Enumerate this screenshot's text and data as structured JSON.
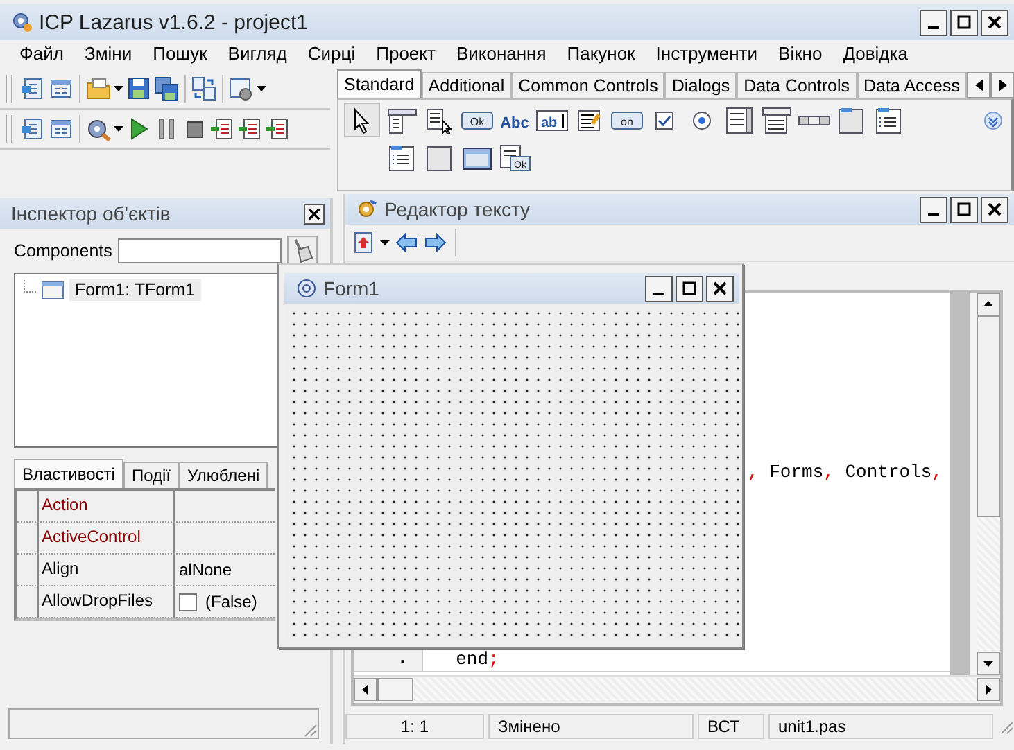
{
  "main_window": {
    "title": "ICP Lazarus v1.6.2 - project1",
    "menu": [
      "Файл",
      "Зміни",
      "Пошук",
      "Вигляд",
      "Сирці",
      "Проект",
      "Виконання",
      "Пакунок",
      "Інструменти",
      "Вікно",
      "Довідка"
    ],
    "palette": {
      "tabs": [
        {
          "label": "Standard",
          "selected": true
        },
        {
          "label": "Additional",
          "selected": false
        },
        {
          "label": "Common Controls",
          "selected": false
        },
        {
          "label": "Dialogs",
          "selected": false
        },
        {
          "label": "Data Controls",
          "selected": false
        },
        {
          "label": "Data Access",
          "selected": false
        }
      ],
      "components": [
        {
          "kind": "pointer",
          "selected": true
        },
        {
          "kind": "menu",
          "selected": false
        },
        {
          "kind": "popup",
          "selected": false
        },
        {
          "kind": "button",
          "label": "Ok",
          "selected": false
        },
        {
          "kind": "label",
          "label": "Abc",
          "selected": false
        },
        {
          "kind": "edit",
          "label": "ab",
          "selected": false
        },
        {
          "kind": "memo",
          "selected": false
        },
        {
          "kind": "toggle",
          "label": "on",
          "selected": false
        },
        {
          "kind": "checkbox",
          "selected": false
        },
        {
          "kind": "radio",
          "selected": false
        },
        {
          "kind": "listbox",
          "selected": false
        },
        {
          "kind": "combobox",
          "selected": false
        },
        {
          "kind": "scrollbar",
          "selected": false
        },
        {
          "kind": "groupbox",
          "selected": false
        },
        {
          "kind": "radiogroup",
          "selected": false
        },
        {
          "kind": "checkgroup",
          "selected": false
        },
        {
          "kind": "panel",
          "selected": false
        },
        {
          "kind": "frame",
          "selected": false
        },
        {
          "kind": "actionlist",
          "label": "Ok",
          "selected": false
        }
      ]
    }
  },
  "object_inspector": {
    "title": "Інспектор об'єктів",
    "filter_label": "Components",
    "tree": [
      {
        "label": "Form1: TForm1",
        "selected": true
      }
    ],
    "tabs": [
      {
        "label": "Властивості",
        "selected": true
      },
      {
        "label": "Події",
        "selected": false
      },
      {
        "label": "Улюблені",
        "selected": false
      }
    ],
    "properties": [
      {
        "name": "Action",
        "kind": "reference"
      },
      {
        "name": "ActiveControl",
        "kind": "reference"
      },
      {
        "name": "Align",
        "kind": "plain",
        "value": "alNone"
      },
      {
        "name": "AllowDropFiles",
        "kind": "plain",
        "checked": false,
        "value": "(False)"
      }
    ]
  },
  "source_editor": {
    "title": "Редактор тексту",
    "code_lines": [
      {
        "tokens": [
          {
            "text": ",",
            "kind": "symbol"
          },
          {
            "text": " Forms",
            "kind": "ident"
          },
          {
            "text": ",",
            "kind": "symbol"
          },
          {
            "text": " Controls",
            "kind": "ident"
          },
          {
            "text": ",",
            "kind": "symbol"
          }
        ]
      },
      {
        "gutter": ".",
        "tokens": [
          {
            "text": "  end",
            "kind": "ident"
          },
          {
            "text": ";",
            "kind": "symbol"
          }
        ]
      }
    ],
    "status": [
      "1: 1",
      "Змінено",
      "ВСТ",
      "unit1.pas"
    ]
  },
  "form_designer": {
    "title": "Form1"
  }
}
